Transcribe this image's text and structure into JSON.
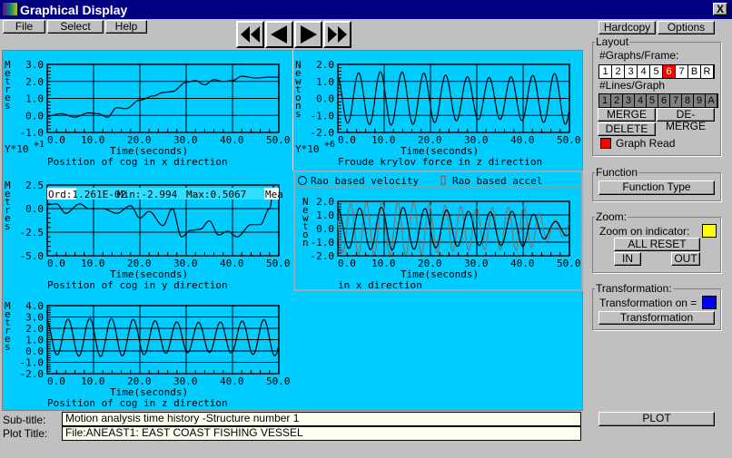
{
  "window": {
    "title": "Graphical Display",
    "close": "X"
  },
  "menu": {
    "file": "File",
    "select": "Select",
    "help": "Help"
  },
  "nav": {
    "first": "first",
    "prev": "previous",
    "next": "next",
    "last": "last"
  },
  "right": {
    "hardcopy": "Hardcopy",
    "options": "Options",
    "layout": {
      "label": "Layout",
      "graphs_label": "#Graphs/Frame:",
      "graphs": [
        "1",
        "2",
        "3",
        "4",
        "5",
        "6",
        "7",
        "B",
        "R"
      ],
      "graphs_selected": "6",
      "lines_label": "#Lines/Graph",
      "lines": [
        "1",
        "2",
        "3",
        "4",
        "5",
        "6",
        "7",
        "8",
        "9",
        "A"
      ],
      "merge": "MERGE",
      "demerge": "DE-MERGE",
      "delete": "DELETE",
      "graph_read": "Graph Read",
      "graph_read_color": "#ff0000"
    },
    "function": {
      "label": "Function",
      "button": "Function Type"
    },
    "zoom": {
      "label": "Zoom:",
      "indicator": "Zoom on indicator:",
      "indicator_color": "#ffff00",
      "all_reset": "ALL  RESET",
      "in": "IN",
      "out": "OUT"
    },
    "transformation": {
      "label": "Transformation:",
      "on": "Transformation on =",
      "on_color": "#0000ff",
      "button": "Transformation"
    },
    "plot": "PLOT"
  },
  "bottom": {
    "subtitle_label": "Sub-title:",
    "subtitle": "Motion analysis time history -Structure number 1",
    "plottitle_label": "Plot Title:",
    "plottitle": "File:ANEAST1:   EAST COAST FISHING VESSEL"
  },
  "colors": {
    "background": "#00ccff",
    "accent": "#000080"
  },
  "graphs": [
    {
      "id": "x",
      "ylabel": "Metres",
      "yticks": [
        "3.0",
        "2.0",
        "1.0",
        "0.0",
        "-1.0"
      ],
      "ylim": [
        -1,
        3
      ],
      "xticks": [
        "0.0",
        "10.0",
        "20.0",
        "30.0",
        "40.0",
        "50.0"
      ],
      "xlabel": "Time(seconds)",
      "title": "Position of cog in x direction",
      "scale": "Y*10",
      "scale_exp": "+1",
      "series": [
        {
          "color": "#000000",
          "points": [
            [
              0,
              -0.05
            ],
            [
              3,
              0.1
            ],
            [
              6,
              -0.1
            ],
            [
              9,
              0.15
            ],
            [
              11,
              0.1
            ],
            [
              13,
              -0.1
            ],
            [
              15,
              0.45
            ],
            [
              17,
              0.4
            ],
            [
              20,
              0.9
            ],
            [
              23,
              1.15
            ],
            [
              25,
              1.35
            ],
            [
              27,
              1.4
            ],
            [
              30,
              1.95
            ],
            [
              32,
              2.05
            ],
            [
              34,
              1.8
            ],
            [
              36,
              2.1
            ],
            [
              38,
              2.0
            ],
            [
              40,
              2.05
            ],
            [
              42,
              2.3
            ],
            [
              45,
              2.2
            ],
            [
              48,
              2.25
            ],
            [
              50,
              2.25
            ]
          ]
        }
      ]
    },
    {
      "id": "fk",
      "ylabel": "Newtons",
      "yticks": [
        "2.0",
        "1.0",
        "0.0",
        "-1.0",
        "-2.0"
      ],
      "ylim": [
        -2,
        2
      ],
      "xticks": [
        "0.0",
        "10.0",
        "20.0",
        "30.0",
        "40.0",
        "50.0"
      ],
      "xlabel": "Time(seconds)",
      "title": "Froude krylov force in z direction",
      "scale": "Y*10",
      "scale_exp": "+6",
      "series": [
        {
          "color": "#000000",
          "wave": {
            "offset": 0,
            "amp": 1.4,
            "period": 4.7,
            "phase": 0.3
          }
        }
      ]
    },
    {
      "id": "y",
      "ylabel": "Metres",
      "yticks": [
        "2.5",
        "0.0",
        "-2.5",
        "-5.0"
      ],
      "ylim": [
        -5,
        2.5
      ],
      "xticks": [
        "0.0",
        "10.0",
        "20.0",
        "30.0",
        "40.0",
        "50.0"
      ],
      "xlabel": "Time(seconds)",
      "title": "Position of cog in y direction",
      "readout": {
        "ord": "Ord:1.261E-02",
        "min": "Min:-2.994",
        "max": "Max:0.5067",
        "mean": "Mea"
      },
      "series": [
        {
          "color": "#000000",
          "points": [
            [
              0,
              0.4
            ],
            [
              2,
              0.5
            ],
            [
              4,
              -0.5
            ],
            [
              7,
              0.5
            ],
            [
              9,
              0
            ],
            [
              12,
              0
            ],
            [
              15,
              -0.5
            ],
            [
              18,
              0.3
            ],
            [
              20,
              -1.0
            ],
            [
              22,
              -0.3
            ],
            [
              25,
              -1.8
            ],
            [
              27,
              0.0
            ],
            [
              29,
              -3.0
            ],
            [
              31,
              -2.3
            ],
            [
              33,
              -2.2
            ],
            [
              35,
              -1.3
            ],
            [
              37,
              -2.8
            ],
            [
              39,
              -2.4
            ],
            [
              41,
              -3.0
            ],
            [
              44,
              -1.7
            ],
            [
              46,
              -1.7
            ],
            [
              48,
              0
            ],
            [
              49,
              2.5
            ]
          ]
        }
      ]
    },
    {
      "id": "vel",
      "ylabel": "Newton",
      "yticks": [
        "2.0",
        "1.0",
        "0.0",
        "-1.0",
        "-2.0"
      ],
      "ylim": [
        -2,
        2
      ],
      "xticks": [
        "0.0",
        "10.0",
        "20.0",
        "30.0",
        "40.0",
        "50.0"
      ],
      "xlabel": "Time(seconds)",
      "title": "in x direction",
      "legend": [
        "Rao based velocity",
        "Rao based accel"
      ],
      "series": [
        {
          "color": "#777777",
          "wave": {
            "offset": 0,
            "amp": 1.75,
            "period": 3.4,
            "phase": 1.2
          }
        },
        {
          "color": "#000000",
          "wave": {
            "offset": 0,
            "amp": 1.4,
            "period": 4.7,
            "phase": 0
          }
        }
      ]
    },
    {
      "id": "z",
      "ylabel": "Metres",
      "yticks": [
        "4.0",
        "3.0",
        "2.0",
        "1.0",
        "0.0",
        "-1.0",
        "-2.0"
      ],
      "ylim": [
        -2,
        4
      ],
      "xticks": [
        "0.0",
        "10.0",
        "20.0",
        "30.0",
        "40.0",
        "50.0"
      ],
      "xlabel": "Time(seconds)",
      "title": "Position of cog in z direction",
      "series": [
        {
          "color": "#000000",
          "wave": {
            "offset": 1.2,
            "amp": 1.5,
            "period": 4.7,
            "phase": 0.3
          }
        }
      ]
    }
  ]
}
